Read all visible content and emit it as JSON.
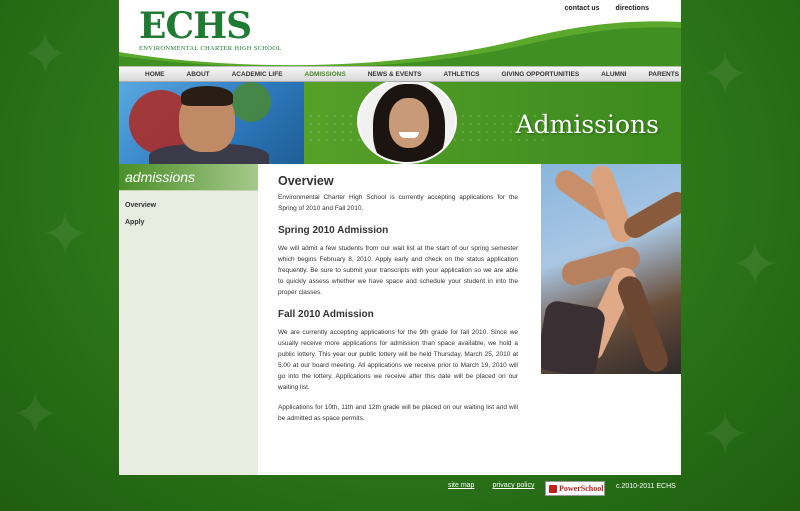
{
  "header": {
    "logo_main": "ECHS",
    "logo_sub": "ENVIRONMENTAL CHARTER HIGH SCHOOL",
    "top_links": [
      "contact us",
      "directions"
    ]
  },
  "nav": {
    "items": [
      "HOME",
      "ABOUT",
      "ACADEMIC LIFE",
      "ADMISSIONS",
      "NEWS & EVENTS",
      "ATHLETICS",
      "GIVING OPPORTUNITIES",
      "ALUMNI",
      "PARENTS"
    ],
    "active": "ADMISSIONS"
  },
  "banner": {
    "title": "Admissions"
  },
  "sidebar": {
    "heading": "admissions",
    "items": [
      "Overview",
      "Apply"
    ]
  },
  "content": {
    "title": "Overview",
    "intro": "Environmental Charter High School is currently accepting applications for the Spring of 2010 and Fall 2010.",
    "spring_heading": "Spring 2010 Admission",
    "spring_text": "We will admit a few students from our wait list at the start of our spring semester which begins February 8, 2010.  Apply early and check on the status application frequently.  Be sure to submit your transcripts with your application so we are able to quickly assess whether we have space and schedule your student in into the proper classes.",
    "fall_heading": "Fall 2010 Admission",
    "fall_text": "We are currently accepting applications for the 9th grade for fall 2010.  Since we usually receive more applications for admission than space available, we hold a public lottery. This year our public lottery will be held Thursday, March 25, 2010 at 5:00 at our board meeting.  All applications we receive prior to March 19, 2010 will go into the lottery.  Applications we receive after this date will be placed on our waiting list.",
    "upper_text": "Applications for 10th, 11th and 12th grade will be placed on our waiting list and will be admitted as space permits."
  },
  "footer": {
    "links": [
      "site map",
      "privacy policy"
    ],
    "badge": "PowerSchool",
    "copyright": "c.2010-2011 ECHS"
  },
  "colors": {
    "brand_green": "#1f7a34",
    "accent_green": "#4caf2a",
    "nav_active": "#4a8a2a",
    "background": "#2f7a1a"
  }
}
